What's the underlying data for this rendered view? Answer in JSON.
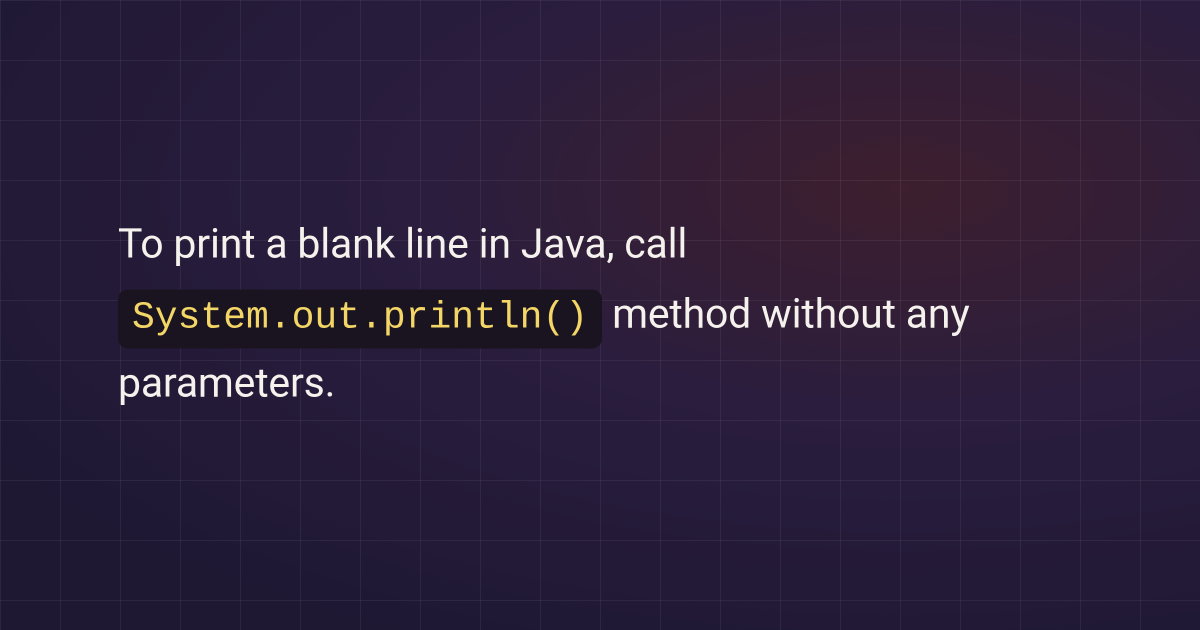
{
  "text_before": "To print a blank line in Java, call ",
  "code_snippet": "System.out.println()",
  "text_after": " method without any parameters."
}
